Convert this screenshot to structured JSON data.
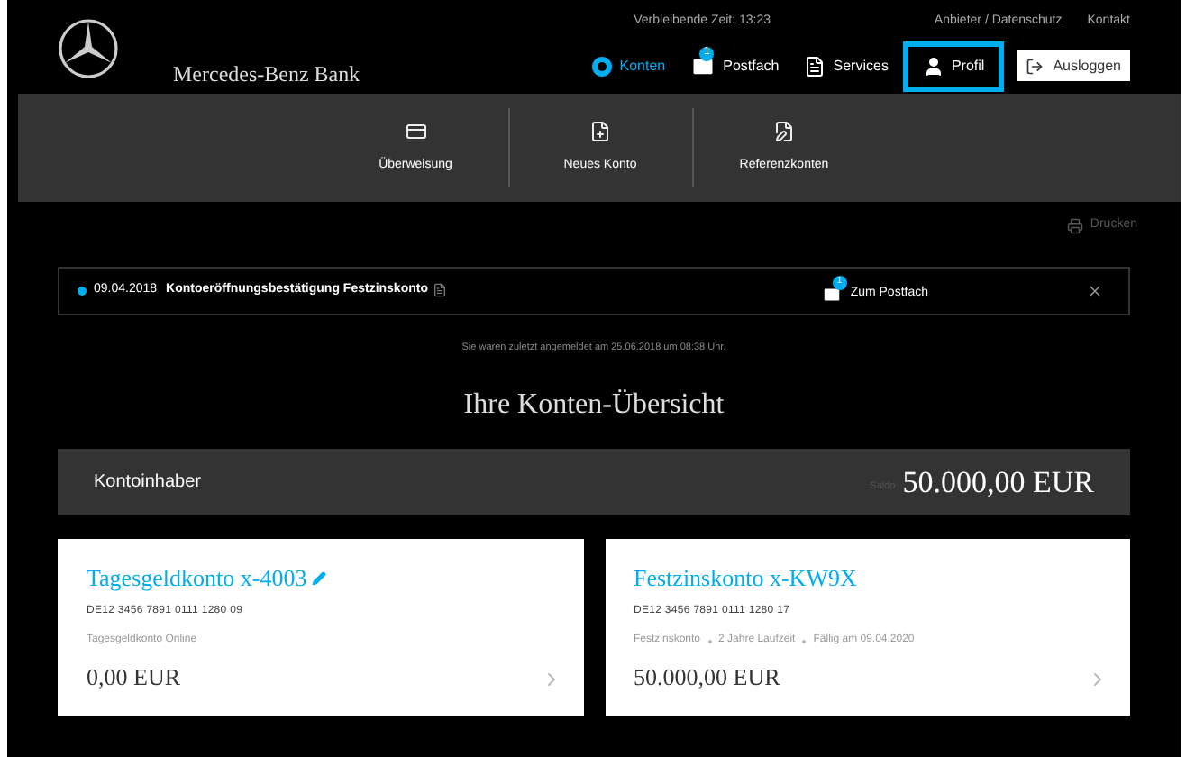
{
  "header": {
    "brand": "Mercedes-Benz Bank",
    "session_time": "Verbleibende Zeit: 13:23",
    "top_links": [
      "Anbieter / Datenschutz",
      "Kontakt"
    ],
    "nav": [
      {
        "label": "Konten",
        "selected": true,
        "highlighted": false
      },
      {
        "label": "Postfach",
        "selected": false,
        "highlighted": false,
        "badge": "1"
      },
      {
        "label": "Services",
        "selected": false,
        "highlighted": false
      },
      {
        "label": "Profil",
        "selected": false,
        "highlighted": true
      }
    ],
    "logout": "Ausloggen"
  },
  "subnav": [
    {
      "label": "Überweisung"
    },
    {
      "label": "Neues Konto"
    },
    {
      "label": "Referenzkonten"
    }
  ],
  "print": "Drucken",
  "notification": {
    "date": "09.04.2018",
    "text": "Kontoeröffnungsbestätigung Festzinskonto",
    "unread": true,
    "link": "Zum Postfach",
    "badge": "1"
  },
  "last_login": "Sie waren zuletzt angemeldet am 25.06.2018 um 08:38 Uhr.",
  "title": "Ihre Konten-Übersicht",
  "owner_bar": {
    "label": "Kontoinhaber",
    "saldo_label": "Saldo",
    "saldo": "50.000,00 EUR"
  },
  "accounts": [
    {
      "name": "Tagesgeldkonto x-4003",
      "editable": true,
      "iban": "DE12 3456 7891 0111 1280 09",
      "details": [
        "Tagesgeldkonto Online"
      ],
      "balance": "0,00 EUR"
    },
    {
      "name": "Festzinskonto x-KW9X",
      "editable": false,
      "iban": "DE12 3456 7891 0111 1280 17",
      "details": [
        "Festzinskonto",
        "2 Jahre Laufzeit",
        "Fällig am 09.04.2020"
      ],
      "balance": "50.000,00 EUR"
    }
  ]
}
